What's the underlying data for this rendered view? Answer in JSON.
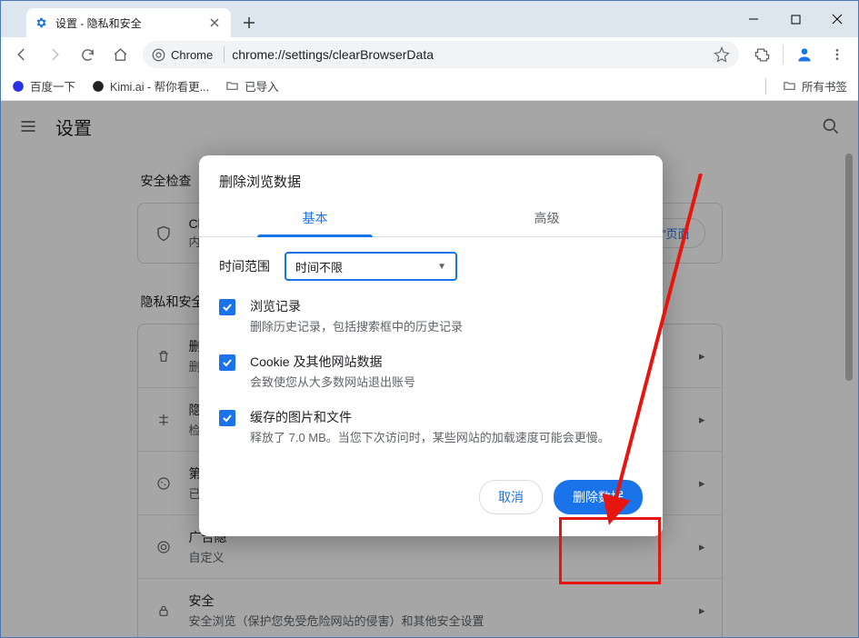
{
  "window": {
    "tab_title": "设置 - 隐私和安全",
    "url": "chrome://settings/clearBrowserData",
    "chrome_chip": "Chrome"
  },
  "bookmarks": {
    "b1": "百度一下",
    "b2": "Kimi.ai - 帮你看更...",
    "b3": "已导入",
    "all": "所有书签"
  },
  "settings": {
    "title": "设置",
    "section_check": "安全检查",
    "check_row": {
      "t1": "Chrome",
      "t2": "内容需",
      "btn": "查\"页面"
    },
    "section_privacy": "隐私和安全",
    "rows": {
      "r1": {
        "t1": "删除浏",
        "t2": "删除历"
      },
      "r2": {
        "t1": "隐私保",
        "t2": "检查重"
      },
      "r3": {
        "t1": "第三方",
        "t2": "已阻止"
      },
      "r4": {
        "t1": "广告隐",
        "t2": "自定义"
      },
      "r5": {
        "t1": "安全",
        "t2": "安全浏览（保护您免受危险网站的侵害）和其他安全设置"
      }
    }
  },
  "dialog": {
    "title": "删除浏览数据",
    "tab_basic": "基本",
    "tab_adv": "高级",
    "time_label": "时间范围",
    "time_value": "时间不限",
    "items": {
      "i1": {
        "t1": "浏览记录",
        "t2": "删除历史记录，包括搜索框中的历史记录"
      },
      "i2": {
        "t1": "Cookie 及其他网站数据",
        "t2": "会致使您从大多数网站退出账号"
      },
      "i3": {
        "t1": "缓存的图片和文件",
        "t2": "释放了 7.0 MB。当您下次访问时，某些网站的加载速度可能会更慢。"
      }
    },
    "cancel": "取消",
    "confirm": "删除数据"
  }
}
